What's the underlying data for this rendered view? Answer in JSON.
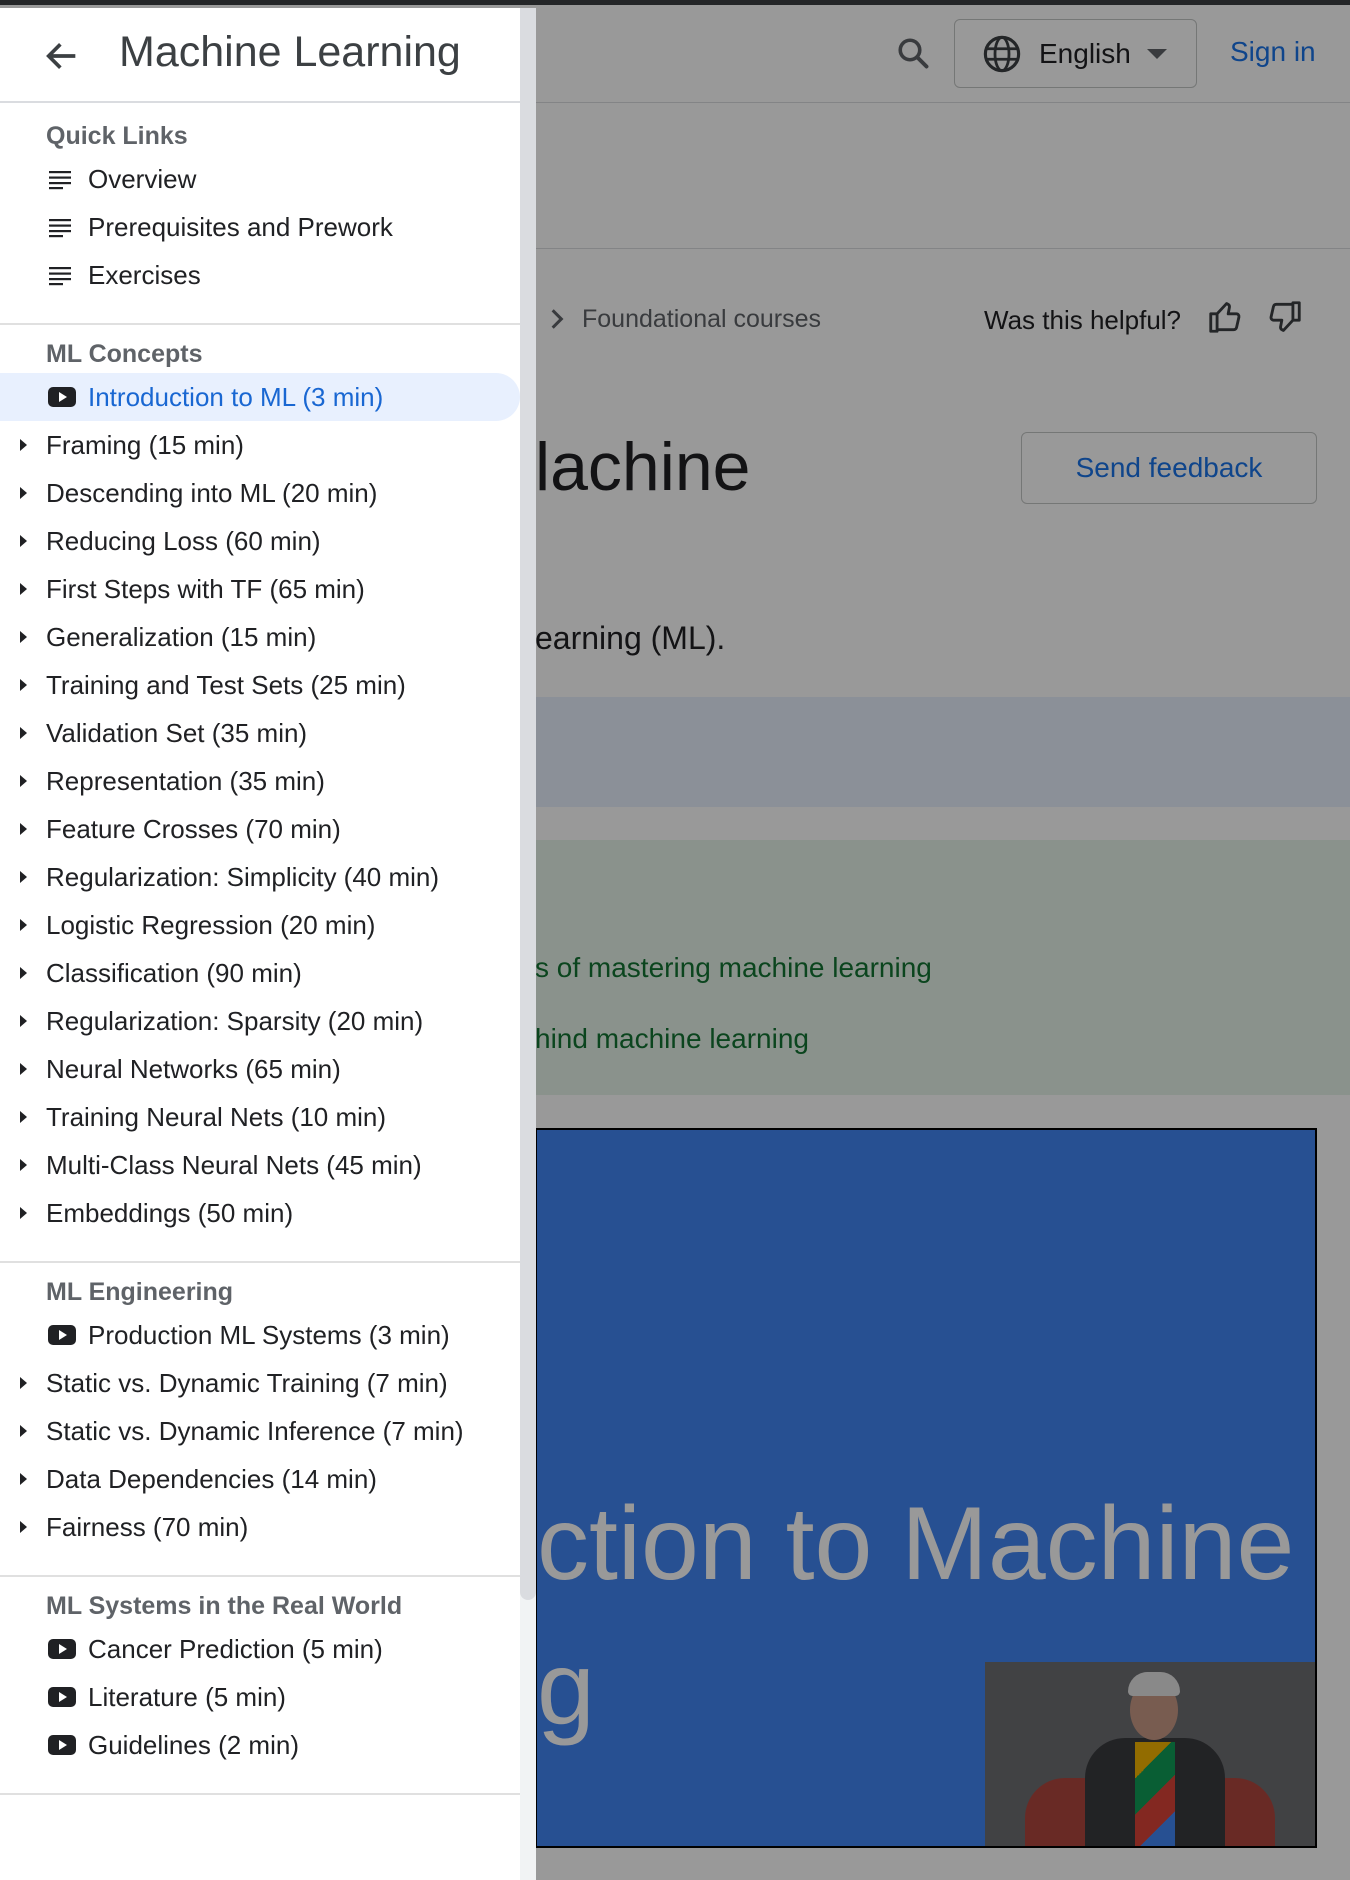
{
  "header": {
    "language_label": "English",
    "signin_label": "Sign in"
  },
  "page": {
    "breadcrumb": "Foundational courses",
    "helpful_prompt": "Was this helpful?",
    "title_fragment": "lachine",
    "send_feedback_label": "Send feedback",
    "intro_fragment": "earning (ML).",
    "objective_1_fragment": "s of mastering machine learning",
    "objective_2_fragment": "hind machine learning",
    "video_title_line1": "ction to Machine",
    "video_title_line2": "g"
  },
  "drawer": {
    "title": "Machine Learning",
    "sections": [
      {
        "title": "Quick Links",
        "items": [
          {
            "label": "Overview",
            "icon": "list-icon"
          },
          {
            "label": "Prerequisites and Prework",
            "icon": "list-icon"
          },
          {
            "label": "Exercises",
            "icon": "list-icon"
          }
        ]
      },
      {
        "title": "ML Concepts",
        "items": [
          {
            "label": "Introduction to ML (3 min)",
            "icon": "youtube-icon",
            "active": true
          },
          {
            "label": "Framing (15 min)",
            "icon": "expand-icon"
          },
          {
            "label": "Descending into ML (20 min)",
            "icon": "expand-icon"
          },
          {
            "label": "Reducing Loss (60 min)",
            "icon": "expand-icon"
          },
          {
            "label": "First Steps with TF (65 min)",
            "icon": "expand-icon"
          },
          {
            "label": "Generalization (15 min)",
            "icon": "expand-icon"
          },
          {
            "label": "Training and Test Sets (25 min)",
            "icon": "expand-icon"
          },
          {
            "label": "Validation Set (35 min)",
            "icon": "expand-icon"
          },
          {
            "label": "Representation (35 min)",
            "icon": "expand-icon"
          },
          {
            "label": "Feature Crosses (70 min)",
            "icon": "expand-icon"
          },
          {
            "label": "Regularization: Simplicity (40 min)",
            "icon": "expand-icon"
          },
          {
            "label": "Logistic Regression (20 min)",
            "icon": "expand-icon"
          },
          {
            "label": "Classification (90 min)",
            "icon": "expand-icon"
          },
          {
            "label": "Regularization: Sparsity (20 min)",
            "icon": "expand-icon"
          },
          {
            "label": "Neural Networks (65 min)",
            "icon": "expand-icon"
          },
          {
            "label": "Training Neural Nets (10 min)",
            "icon": "expand-icon"
          },
          {
            "label": "Multi-Class Neural Nets (45 min)",
            "icon": "expand-icon"
          },
          {
            "label": "Embeddings (50 min)",
            "icon": "expand-icon"
          }
        ]
      },
      {
        "title": "ML Engineering",
        "items": [
          {
            "label": "Production ML Systems (3 min)",
            "icon": "youtube-icon"
          },
          {
            "label": "Static vs. Dynamic Training (7 min)",
            "icon": "expand-icon"
          },
          {
            "label": "Static vs. Dynamic Inference (7 min)",
            "icon": "expand-icon"
          },
          {
            "label": "Data Dependencies (14 min)",
            "icon": "expand-icon"
          },
          {
            "label": "Fairness (70 min)",
            "icon": "expand-icon"
          }
        ]
      },
      {
        "title": "ML Systems in the Real World",
        "items": [
          {
            "label": "Cancer Prediction (5 min)",
            "icon": "youtube-icon"
          },
          {
            "label": "Literature (5 min)",
            "icon": "youtube-icon"
          },
          {
            "label": "Guidelines (2 min)",
            "icon": "youtube-icon"
          }
        ]
      }
    ]
  },
  "colors": {
    "accent": "#1a73e8",
    "active_bg": "#e8f0fe",
    "video_bg": "#4285f4"
  }
}
